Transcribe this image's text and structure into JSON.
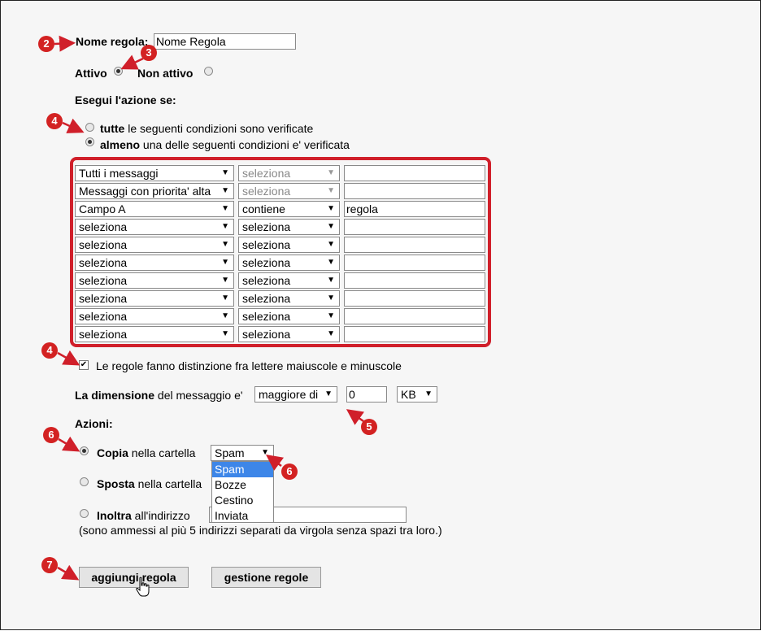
{
  "rule_name": {
    "label": "Nome regola:",
    "value": "Nome Regola"
  },
  "status": {
    "active_label": "Attivo",
    "inactive_label": "Non attivo",
    "selected": "active"
  },
  "conditions": {
    "heading": "Esegui l'azione se:",
    "match_all": {
      "bold": "tutte",
      "rest": "le seguenti condizioni sono verificate",
      "checked": false
    },
    "match_any": {
      "bold": "almeno",
      "rest": "una delle seguenti condizioni e' verificata",
      "checked": true
    },
    "rows": [
      {
        "field": "Tutti i messaggi",
        "operator": "seleziona",
        "value": "",
        "operator_disabled": true
      },
      {
        "field": "Messaggi con priorita' alta",
        "operator": "seleziona",
        "value": "",
        "operator_disabled": true
      },
      {
        "field": "Campo A",
        "operator": "contiene",
        "value": "regola",
        "operator_disabled": false
      },
      {
        "field": "seleziona",
        "operator": "seleziona",
        "value": "",
        "operator_disabled": false
      },
      {
        "field": "seleziona",
        "operator": "seleziona",
        "value": "",
        "operator_disabled": false
      },
      {
        "field": "seleziona",
        "operator": "seleziona",
        "value": "",
        "operator_disabled": false
      },
      {
        "field": "seleziona",
        "operator": "seleziona",
        "value": "",
        "operator_disabled": false
      },
      {
        "field": "seleziona",
        "operator": "seleziona",
        "value": "",
        "operator_disabled": false
      },
      {
        "field": "seleziona",
        "operator": "seleziona",
        "value": "",
        "operator_disabled": false
      },
      {
        "field": "seleziona",
        "operator": "seleziona",
        "value": "",
        "operator_disabled": false
      }
    ]
  },
  "case_sensitive": {
    "label": "Le regole fanno distinzione fra lettere maiuscole e minuscole",
    "checked": true
  },
  "size": {
    "bold": "La dimensione",
    "rest": "del messaggio e'",
    "comparator": "maggiore di",
    "value": "0",
    "unit": "KB"
  },
  "actions": {
    "heading": "Azioni:",
    "copy": {
      "bold": "Copia",
      "rest": "nella cartella",
      "checked": true,
      "folder": "Spam"
    },
    "move": {
      "bold": "Sposta",
      "rest": "nella cartella",
      "checked": false
    },
    "forward": {
      "bold": "Inoltra",
      "rest": "all'indirizzo",
      "checked": false,
      "value": ""
    },
    "forward_note": "(sono ammessi al più 5 indirizzi separati da virgola senza spazi tra loro.)",
    "folder_options": [
      "Spam",
      "Bozze",
      "Cestino",
      "Inviata"
    ],
    "folder_selected": "Spam"
  },
  "buttons": {
    "add": "aggiungi regola",
    "manage": "gestione regole"
  },
  "badges": [
    "2",
    "3",
    "4",
    "4",
    "5",
    "6",
    "6",
    "7"
  ],
  "colors": {
    "accent": "#d01f2a",
    "badge": "#d32222",
    "highlight": "#3d86e8"
  }
}
